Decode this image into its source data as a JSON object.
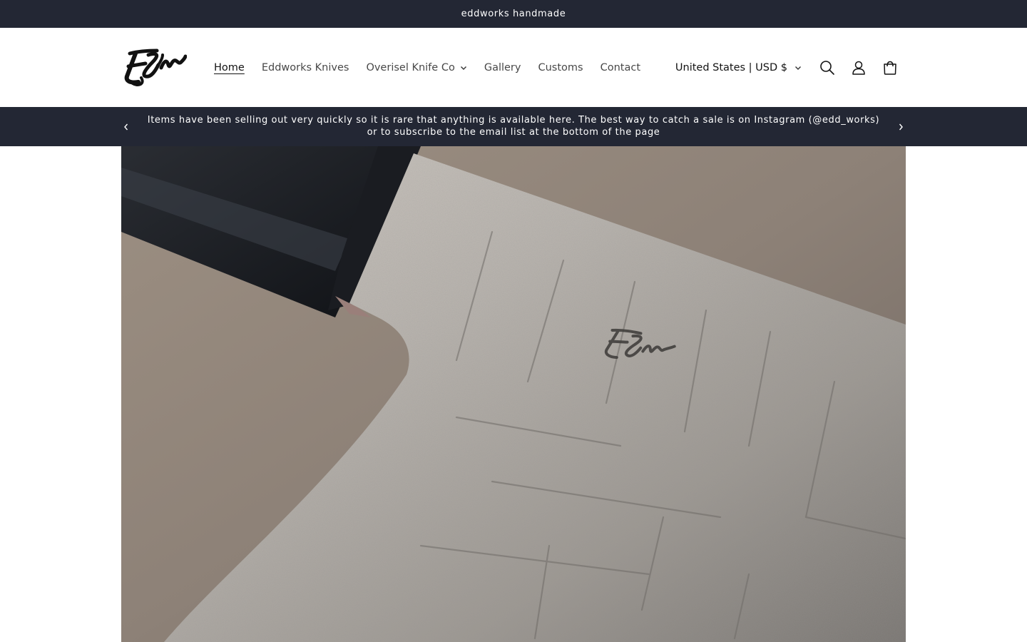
{
  "topbar": {
    "text": "eddworks handmade"
  },
  "header": {
    "logo": {
      "name": "eddworks-logo"
    },
    "nav": [
      {
        "label": "Home",
        "active": true,
        "has_dropdown": false
      },
      {
        "label": "Eddworks Knives",
        "active": false,
        "has_dropdown": false
      },
      {
        "label": "Overisel Knife Co",
        "active": false,
        "has_dropdown": true
      },
      {
        "label": "Gallery",
        "active": false,
        "has_dropdown": false
      },
      {
        "label": "Customs",
        "active": false,
        "has_dropdown": false
      },
      {
        "label": "Contact",
        "active": false,
        "has_dropdown": false
      }
    ],
    "country_selector": "United States | USD $",
    "icons": [
      "search-icon",
      "account-icon",
      "cart-icon"
    ]
  },
  "announcement": {
    "line1": "Items have been selling out very quickly so it is rare that anything is available here. The best way to catch a sale is on Instagram (@edd_works)",
    "line2": "or to subscribe to the email list at the bottom of the page"
  },
  "hero": {
    "image": "knife-blade-closeup"
  },
  "colors": {
    "dark_bar": "#232734",
    "background": "#ffffff",
    "text": "#121212"
  }
}
